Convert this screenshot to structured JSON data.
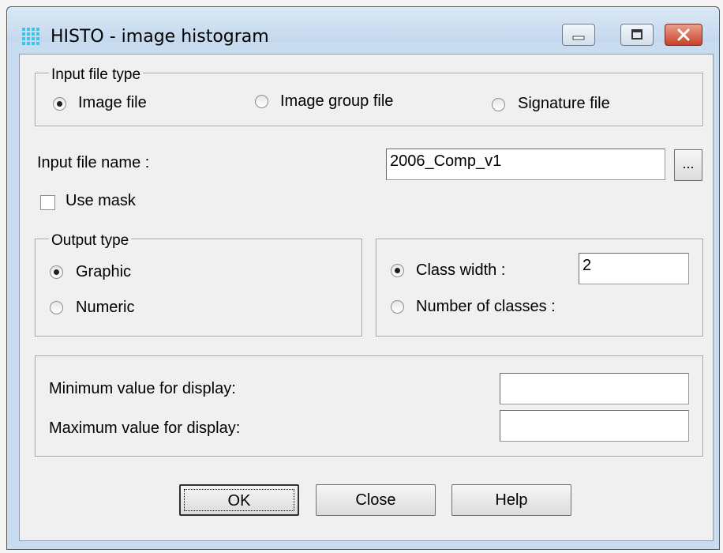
{
  "window": {
    "title": "HISTO - image histogram",
    "icon": "grid-icon"
  },
  "input_file_type": {
    "legend": "Input file type",
    "options": [
      {
        "label": "Image file",
        "selected": true
      },
      {
        "label": "Image group file",
        "selected": false
      },
      {
        "label": "Signature file",
        "selected": false
      }
    ]
  },
  "input_file": {
    "label": "Input file name :",
    "value": "2006_Comp_v1",
    "browse_label": "..."
  },
  "mask": {
    "label": "Use mask",
    "checked": false
  },
  "output_type": {
    "legend": "Output type",
    "options": [
      {
        "label": "Graphic",
        "selected": true
      },
      {
        "label": "Numeric",
        "selected": false
      }
    ]
  },
  "classes": {
    "options": [
      {
        "label": "Class width :",
        "selected": true
      },
      {
        "label": "Number of classes :",
        "selected": false
      }
    ],
    "class_width_value": "2"
  },
  "display_range": {
    "min_label": "Minimum value for display:",
    "min_value": "",
    "max_label": "Maximum value for display:",
    "max_value": ""
  },
  "buttons": {
    "ok": "OK",
    "close": "Close",
    "help": "Help"
  },
  "colors": {
    "titlebar": "#c9dcef",
    "close_button": "#c7422b",
    "client_bg": "#f0f0f0"
  }
}
